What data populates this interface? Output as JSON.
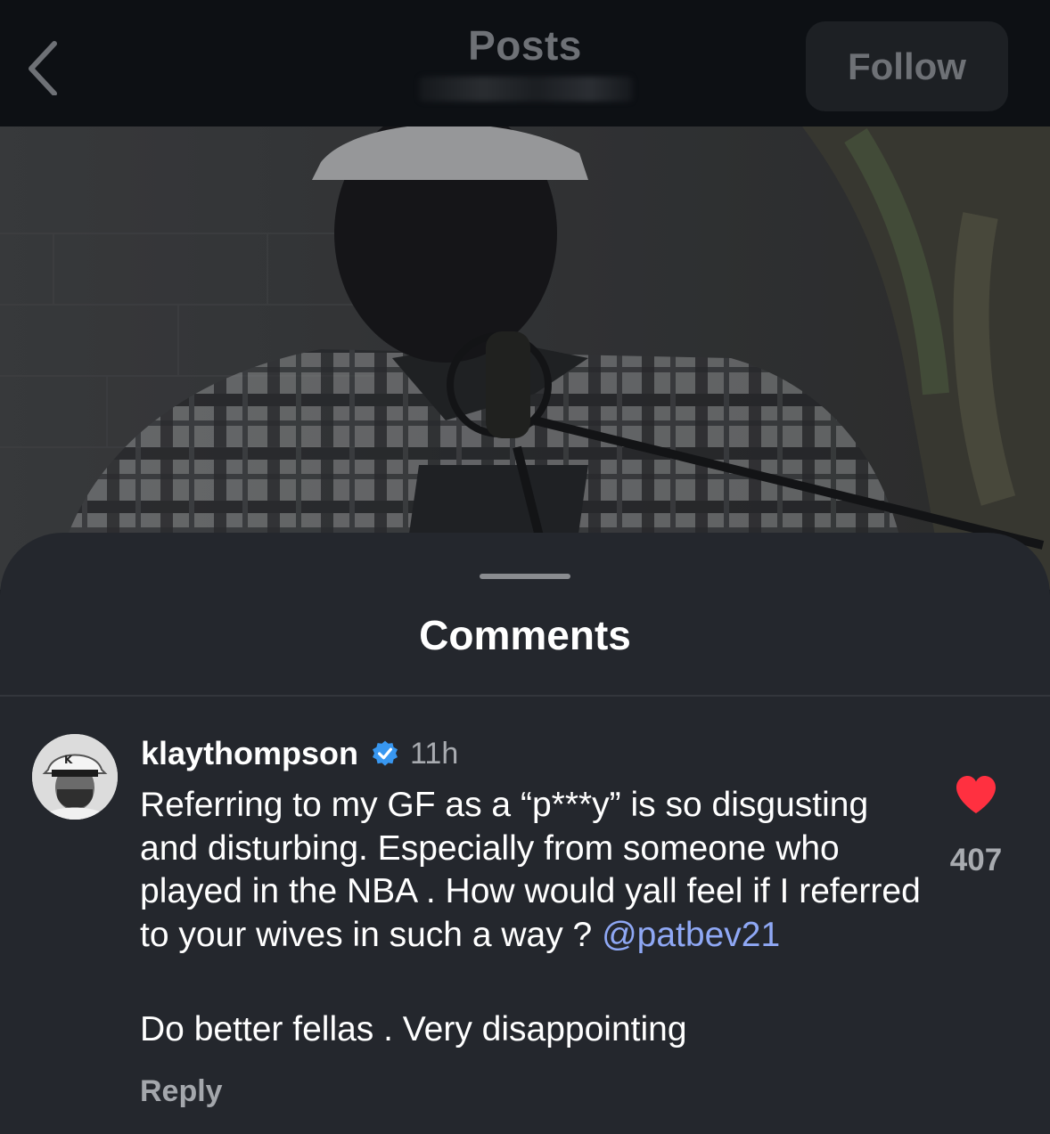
{
  "header": {
    "title": "Posts",
    "follow_label": "Follow"
  },
  "sheet": {
    "title": "Comments"
  },
  "comment": {
    "username": "klaythompson",
    "verified": true,
    "timestamp": "11h",
    "text": "Referring to my GF as a “p***y” is so disgusting and disturbing. Especially from someone who played in the NBA . How would yall feel if I referred to your wives in such a way ?",
    "mention": "@patbev21",
    "text2": "Do better fellas . Very disappointing",
    "reply_label": "Reply",
    "like_count": "407",
    "liked": true
  },
  "colors": {
    "like": "#ff3040",
    "verified": "#3897f0",
    "mention": "#8fa8f5",
    "sheet_bg": "#24272d"
  },
  "icons": [
    "back-chevron-icon",
    "verified-badge-icon",
    "heart-icon"
  ]
}
